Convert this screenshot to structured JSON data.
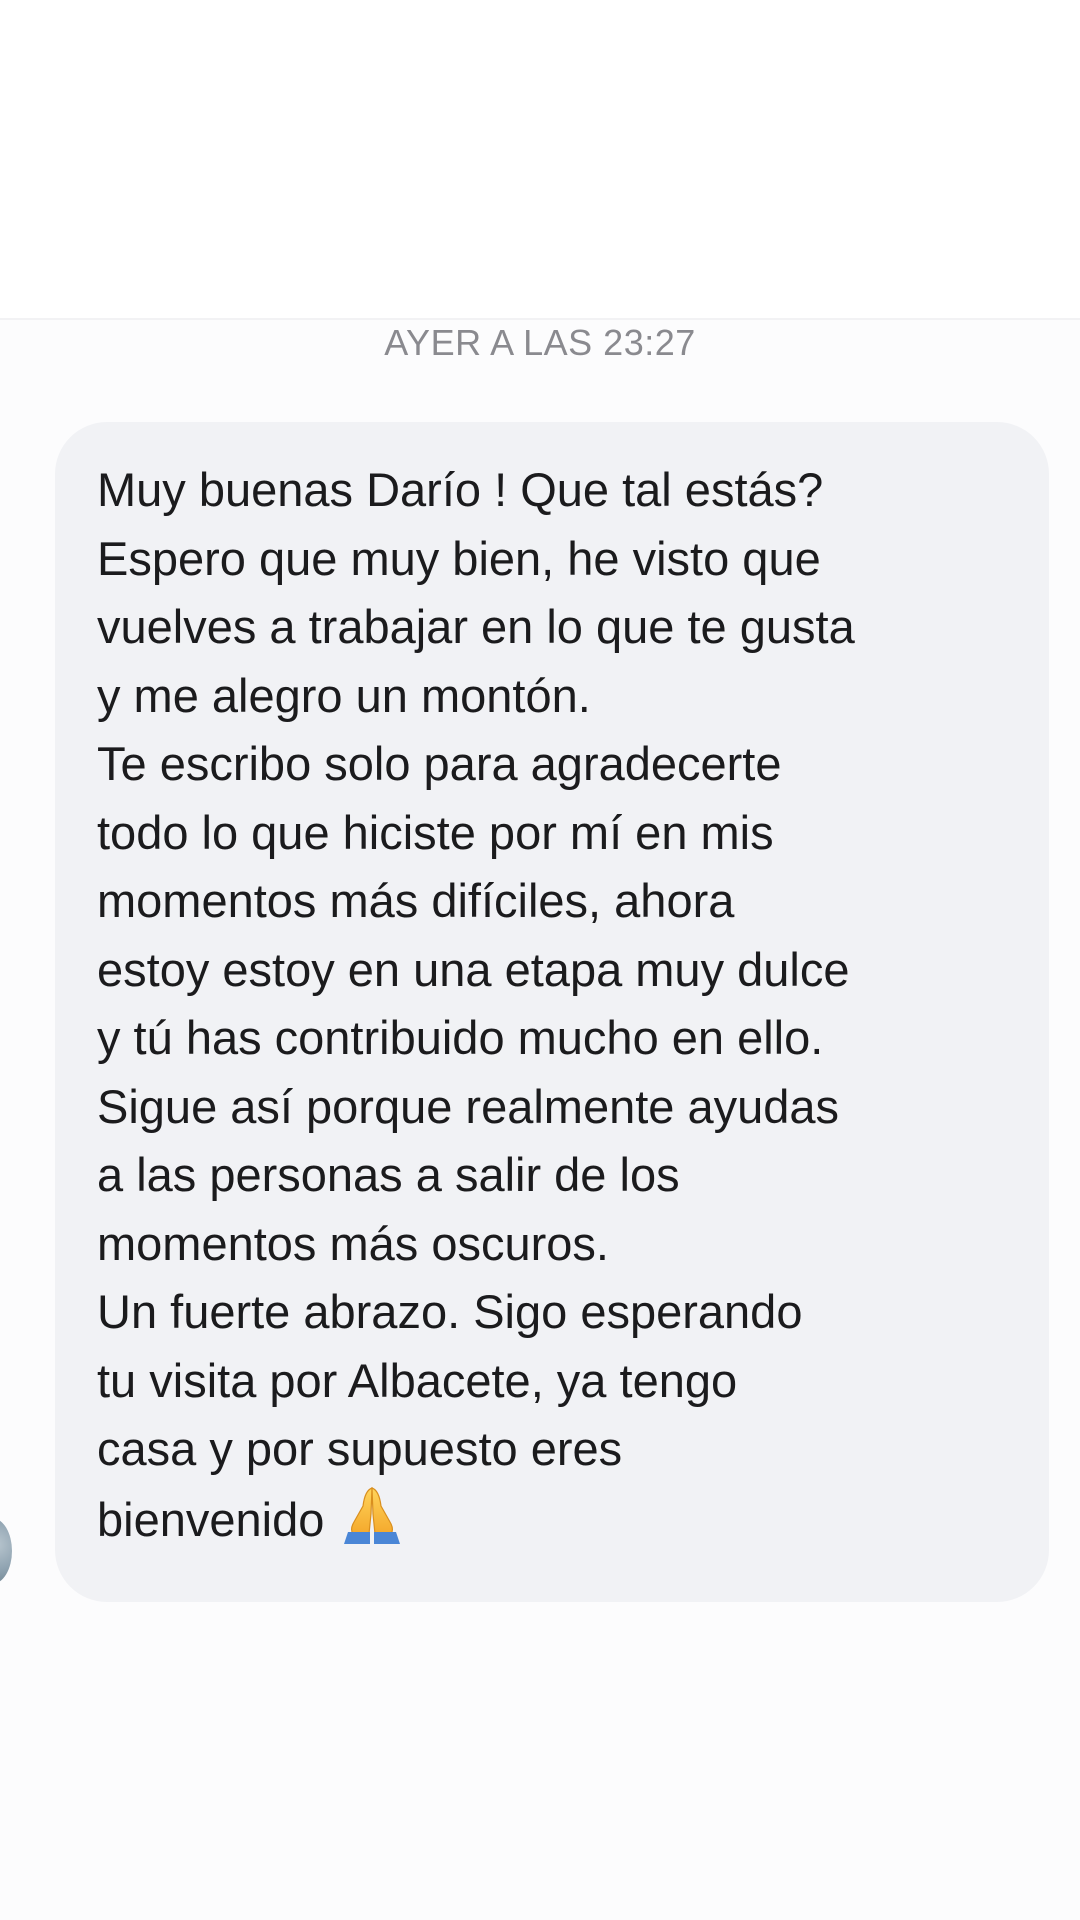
{
  "conversation": {
    "timestamp": "AYER A LAS 23:27",
    "message": {
      "lines": [
        "Muy buenas Darío ! Que tal estás?",
        "Espero que muy bien, he visto que",
        "vuelves a trabajar en lo que te gusta",
        "y me alegro un montón.",
        "Te escribo solo para agradecerte",
        "todo lo que hiciste por mí en mis",
        "momentos más difíciles, ahora",
        "estoy estoy en una etapa muy dulce",
        "y tú has contribuido mucho en ello.",
        "Sigue así porque realmente ayudas",
        "a las personas a salir de los",
        "momentos más oscuros.",
        "Un fuerte abrazo. Sigo esperando",
        "tu visita por Albacete, ya tengo",
        "casa y por supuesto eres",
        "bienvenido"
      ],
      "emoji": "folded-hands-emoji"
    }
  },
  "colors": {
    "bubble_background": "#f1f2f5",
    "text": "#1b1b1d",
    "timestamp": "#8a8a8f"
  }
}
